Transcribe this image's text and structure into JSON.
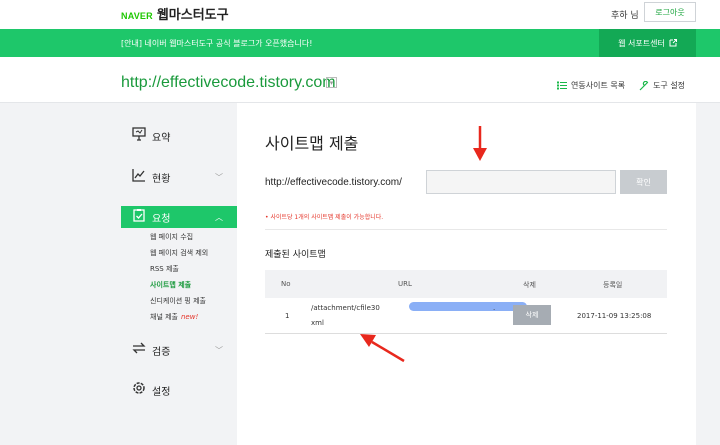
{
  "header": {
    "naver": "NAVER",
    "title": "웹마스터도구",
    "user": "후하 님",
    "logout": "로그아웃"
  },
  "notice": {
    "text": "[안내] 네이버 웹마스터도구 공식 블로그가 오픈했습니다!",
    "support": "웹 서포트센터",
    "support_icon": "external-link-icon"
  },
  "site": {
    "url": "http://effectivecode.tistory.com",
    "links": [
      {
        "label": "연동사이트 목록",
        "icon": "list-icon"
      },
      {
        "label": "도구 설정",
        "icon": "wrench-icon"
      }
    ]
  },
  "sidebar": {
    "items": [
      {
        "label": "요약",
        "icon": "presentation-icon"
      },
      {
        "label": "현황",
        "icon": "trend-chart-icon"
      },
      {
        "label": "요청",
        "icon": "clipboard-icon"
      },
      {
        "label": "검증",
        "icon": "sync-icon"
      },
      {
        "label": "설정",
        "icon": "gear-icon"
      }
    ],
    "sub": [
      {
        "label": "웹 페이지 수집"
      },
      {
        "label": "웹 페이지 검색 제외"
      },
      {
        "label": "RSS 제출"
      },
      {
        "label": "사이트맵 제출"
      },
      {
        "label": "신디케이션 핑 제출"
      },
      {
        "label": "채널 제출",
        "badge": "new!"
      }
    ]
  },
  "main": {
    "title": "사이트맵 제출",
    "prefix": "http://effectivecode.tistory.com/",
    "input_value": "",
    "confirm": "확인",
    "hint": "• 사이트당 1개의 사이트맵 제출이 가능합니다.",
    "submitted_title": "제출된 사이트맵",
    "columns": [
      "No",
      "URL",
      "삭제",
      "등록일"
    ],
    "rows": [
      {
        "no": "1",
        "url_start": "/attachment/cfile30",
        "url_end": ".",
        "url_line2": "xml",
        "delete": "삭제",
        "date": "2017-11-09 13:25:08"
      }
    ]
  },
  "colors": {
    "accent": "#1ec76a",
    "accent_dark": "#13a955",
    "site_link": "#1a9a3c",
    "warning": "#e5362b",
    "annotation": "#e8281d"
  }
}
